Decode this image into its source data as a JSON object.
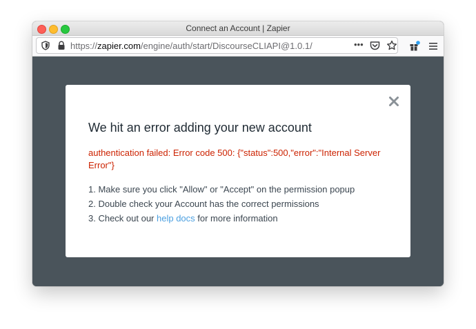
{
  "window": {
    "title": "Connect an Account | Zapier"
  },
  "urlbar": {
    "prefix": "https://",
    "host": "zapier.com",
    "path": "/engine/auth/start/DiscourseCLIAPI@1.0.1/",
    "more_glyph": "•••"
  },
  "modal": {
    "title": "We hit an error adding your new account",
    "error": "authentication failed: Error code 500: {\"status\":500,\"error\":\"Internal Server Error\"}",
    "steps": {
      "step1": "1. Make sure you click \"Allow\" or \"Accept\" on the permission popup",
      "step2": "2. Double check your Account has the correct permissions",
      "step3_before": "3. Check out our ",
      "step3_link": "help docs",
      "step3_after": " for more information"
    }
  },
  "colors": {
    "overlay": "#4a545b",
    "error_text": "#cc2200",
    "link": "#4a9fe0"
  },
  "icons": [
    "shield-icon",
    "lock-icon",
    "pocket-icon",
    "star-icon",
    "gift-icon",
    "hamburger-menu-icon",
    "close-icon"
  ]
}
